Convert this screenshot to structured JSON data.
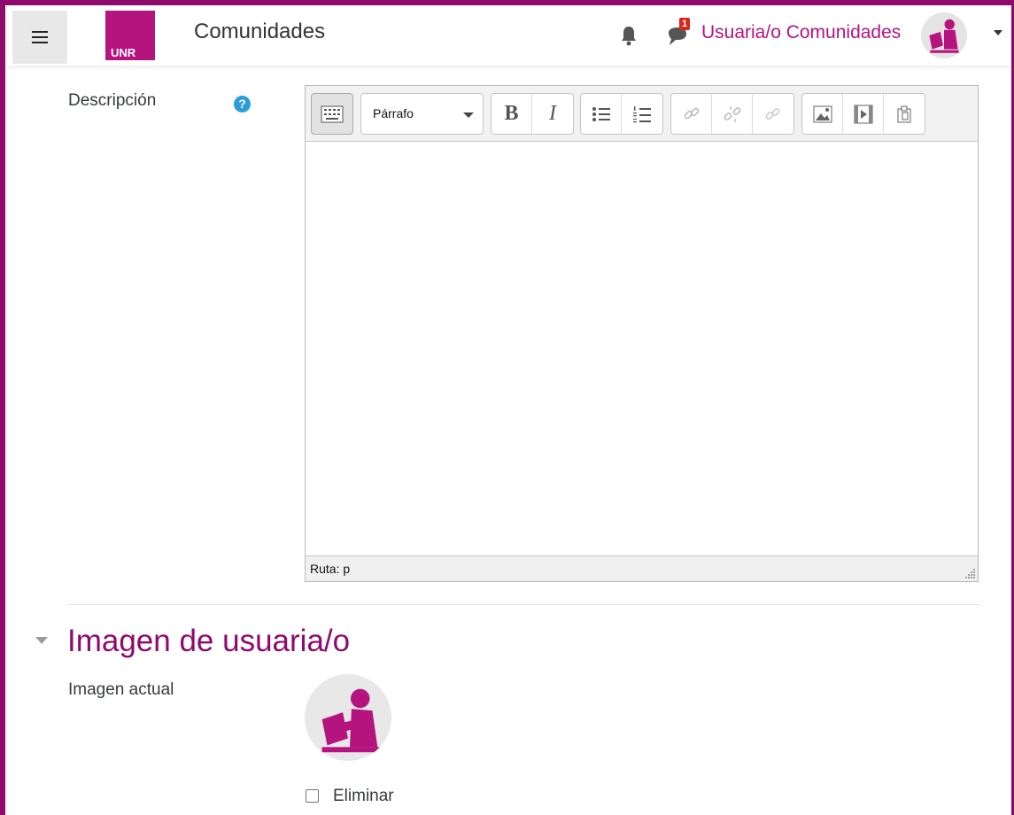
{
  "navbar": {
    "logo_text": "UNR",
    "site_name": "Comunidades",
    "messages_badge": "1",
    "user_name": "Usuaria/o Comunidades"
  },
  "form": {
    "description_label": "Descripción",
    "help_glyph": "?",
    "editor": {
      "format_select": "Párrafo",
      "bold_label": "B",
      "italic_label": "I",
      "status_path": "Ruta: p"
    },
    "section_title": "Imagen de usuaria/o",
    "current_image_label": "Imagen actual",
    "delete_label": "Eliminar",
    "delete_checked": false
  },
  "colors": {
    "brand": "#8f0a6d",
    "logo": "#b5147f",
    "help": "#2b9ed8",
    "badge": "#d9261c"
  },
  "icons": [
    "menu-icon",
    "bell-icon",
    "message-icon",
    "user-avatar",
    "help-icon",
    "keyboard-icon",
    "bullet-list-icon",
    "numbered-list-icon",
    "link-icon",
    "unlink-icon",
    "anchor-icon",
    "image-icon",
    "media-icon",
    "paste-icon",
    "chevron-down-icon"
  ]
}
